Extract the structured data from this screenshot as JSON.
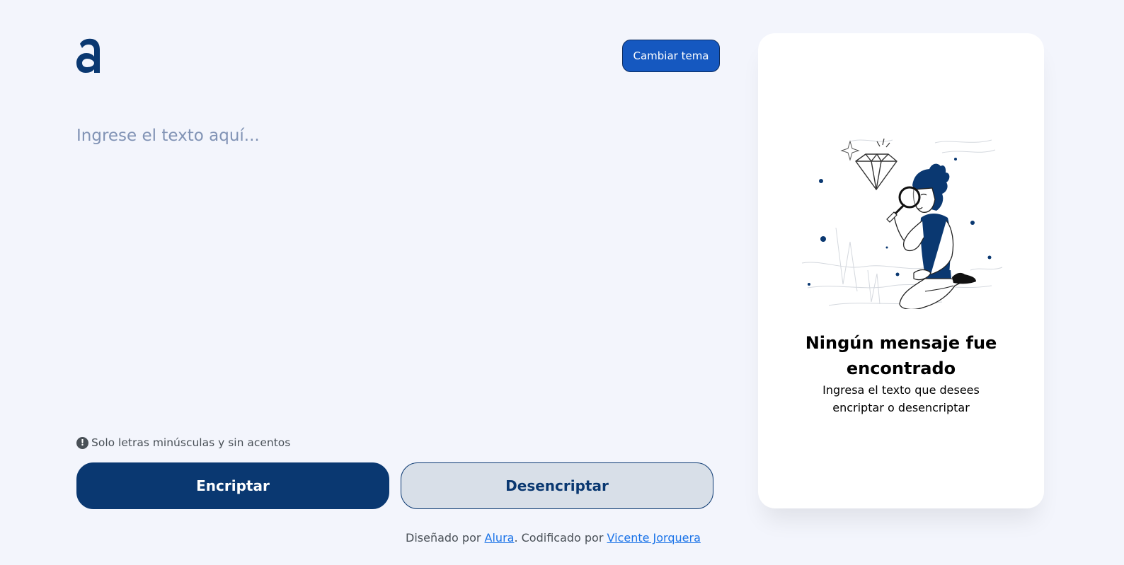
{
  "header": {
    "logo_icon": "alura-a-logo-icon",
    "theme_button_label": "Cambiar tema"
  },
  "editor": {
    "placeholder": "Ingrese el texto aquí...",
    "value": ""
  },
  "hint": {
    "icon": "exclamation-circle-icon",
    "text": "Solo letras minúsculas y sin acentos"
  },
  "actions": {
    "encrypt_label": "Encriptar",
    "decrypt_label": "Desencriptar"
  },
  "footer": {
    "prefix": "Diseñado por ",
    "alura_link": "Alura",
    "middle": ". Codificado por ",
    "author_link": "Vicente Jorquera"
  },
  "output_panel": {
    "illustration": "person-with-magnifier-looking-at-diamond-illustration",
    "title": "Ningún mensaje fue encontrado",
    "subtitle": "Ingresa el texto que desees encriptar o desencriptar"
  },
  "colors": {
    "background": "#f3f5fc",
    "primary": "#0a3871",
    "theme_button": "#1558c0",
    "secondary_button": "#d8dfe8",
    "link": "#1a73e8"
  }
}
